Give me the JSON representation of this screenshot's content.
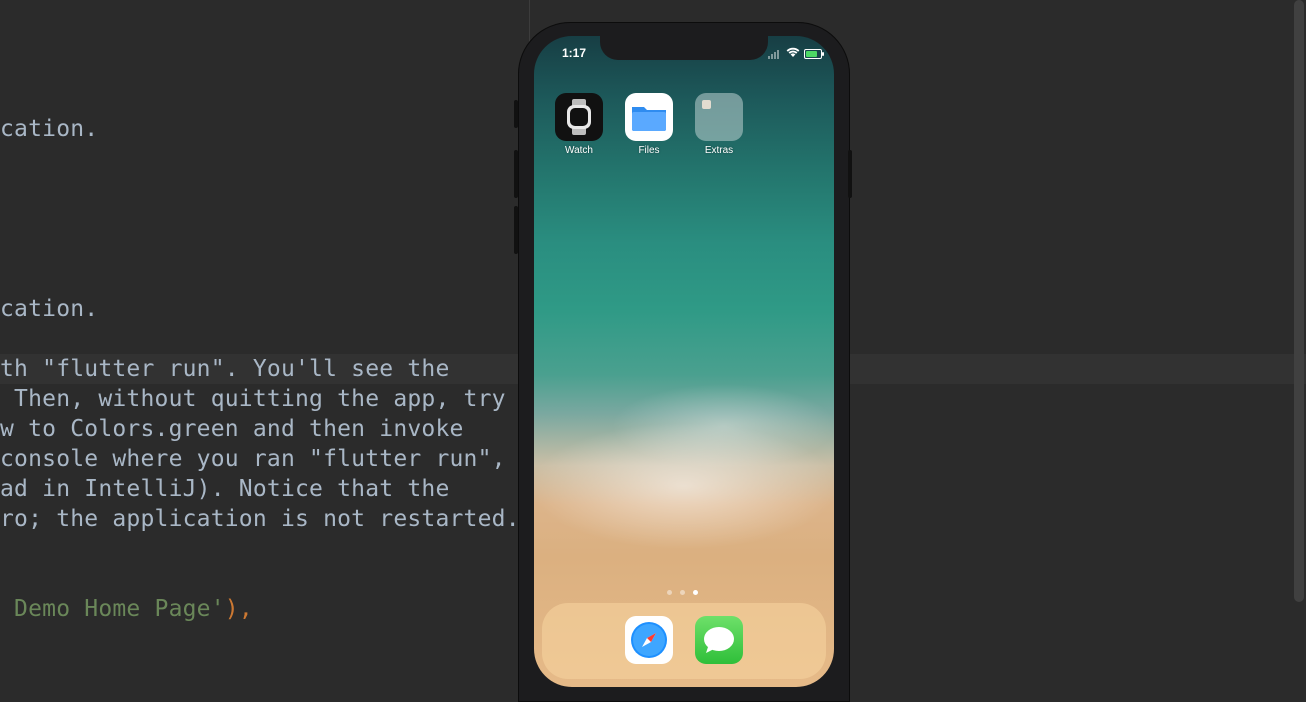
{
  "editor": {
    "lines": [
      {
        "text": "cation."
      },
      {
        "text": "cation."
      },
      {
        "text": "th \"flutter run\". You'll see the"
      },
      {
        "text": " Then, without quitting the app, try"
      },
      {
        "text": "w to Colors.green and then invoke"
      },
      {
        "text": "console where you ran \"flutter run\","
      },
      {
        "text": "ad in IntelliJ). Notice that the"
      },
      {
        "text": "ro; the application is not restarted."
      }
    ],
    "string_line": {
      "text": " Demo Home Page'",
      "punct": "),"
    }
  },
  "phone": {
    "status_bar": {
      "time": "1:17",
      "battery_level_percent": 80
    },
    "home_apps": [
      {
        "label": "Watch",
        "icon": "apple-watch-icon"
      },
      {
        "label": "Files",
        "icon": "folder-icon"
      },
      {
        "label": "Extras",
        "icon": "folder-group-icon"
      }
    ],
    "page_indicator": {
      "count": 3,
      "active_index": 2
    },
    "dock_apps": [
      {
        "label": "Safari",
        "icon": "compass-icon"
      },
      {
        "label": "Messages",
        "icon": "speech-bubble-icon"
      }
    ]
  },
  "colors": {
    "editor_bg": "#2b2b2b",
    "code_text": "#a9b7c6",
    "code_string": "#6a8759",
    "code_punct": "#cc7832"
  }
}
